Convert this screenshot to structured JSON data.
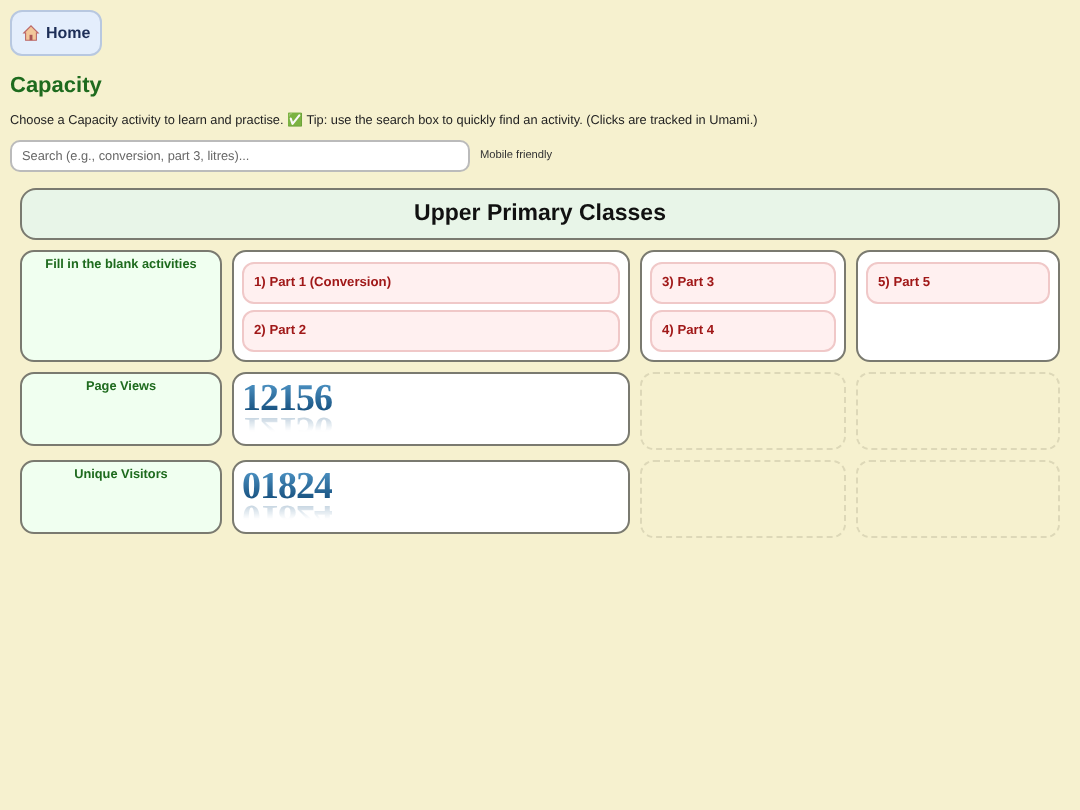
{
  "home_button": {
    "label": "Home"
  },
  "title": "Capacity",
  "intro": "Choose a Capacity activity to learn and practise. ✅ Tip: use the search box to quickly find an activity. (Clicks are tracked in Umami.)",
  "search": {
    "placeholder": "Search (e.g., conversion, part 3, litres)...",
    "note": "Mobile friendly"
  },
  "section_heading": "Upper Primary Classes",
  "rows": [
    {
      "label": "Fill in the blank activities",
      "kind": "links",
      "groups": [
        [
          "1) Part 1 (Conversion)",
          "2) Part 2"
        ],
        [
          "3) Part 3",
          "4) Part 4"
        ],
        [
          "5) Part 5"
        ]
      ]
    },
    {
      "label": "Page Views",
      "kind": "counter",
      "value": "12156"
    },
    {
      "label": "Unique Visitors",
      "kind": "counter",
      "value": "01824"
    }
  ]
}
